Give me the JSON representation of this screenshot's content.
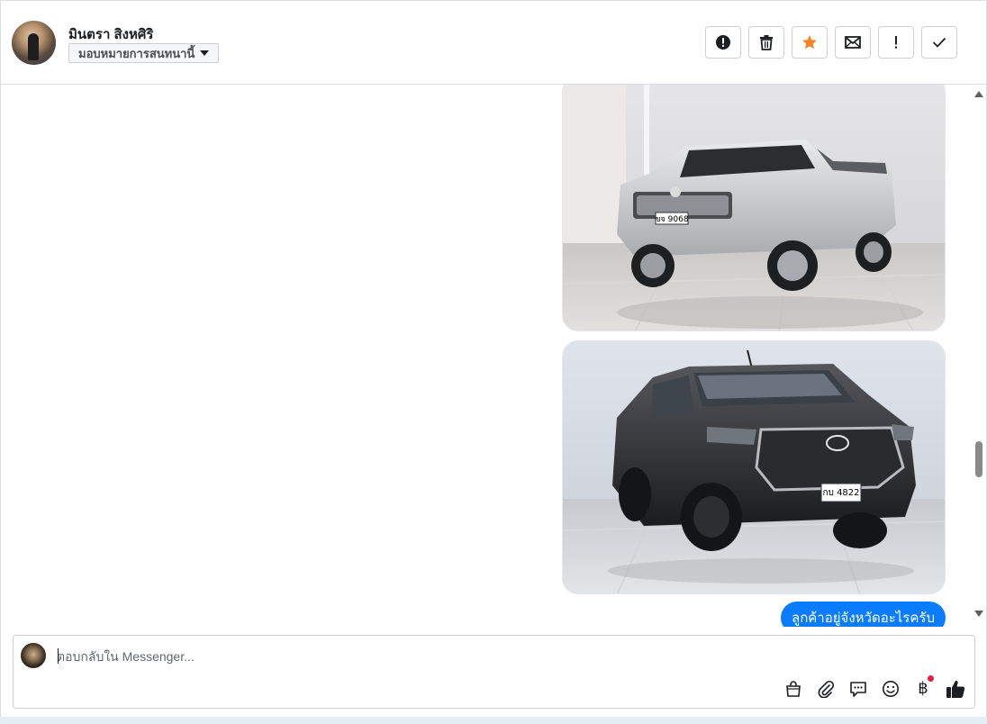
{
  "header": {
    "contact_name": "มินตรา สิงหศิริ",
    "assign_label": "มอบหมายการสนทนานี้",
    "actions": [
      {
        "icon": "alert-circle-icon"
      },
      {
        "icon": "trash-icon"
      },
      {
        "icon": "star-icon",
        "color": "#f5831f"
      },
      {
        "icon": "envelope-icon"
      },
      {
        "icon": "exclamation-icon"
      },
      {
        "icon": "check-icon"
      }
    ]
  },
  "messages": [
    {
      "type": "image",
      "depicts": "silver Toyota Hilux Vigo pickup"
    },
    {
      "type": "image",
      "depicts": "dark Toyota Hilux Revo pickup"
    },
    {
      "type": "text",
      "text": "ลูกค้าอยู่จังหวัดอะไรครับ"
    }
  ],
  "composer": {
    "placeholder": "ตอบกลับใน Messenger...",
    "tools": [
      "shopping-bag-icon",
      "paperclip-icon",
      "chat-bubble-icon",
      "emoji-icon",
      "baht-icon",
      "thumbs-up-icon"
    ],
    "baht_symbol": "฿"
  },
  "colors": {
    "bubble": "#0a7cff",
    "star": "#f5831f"
  }
}
